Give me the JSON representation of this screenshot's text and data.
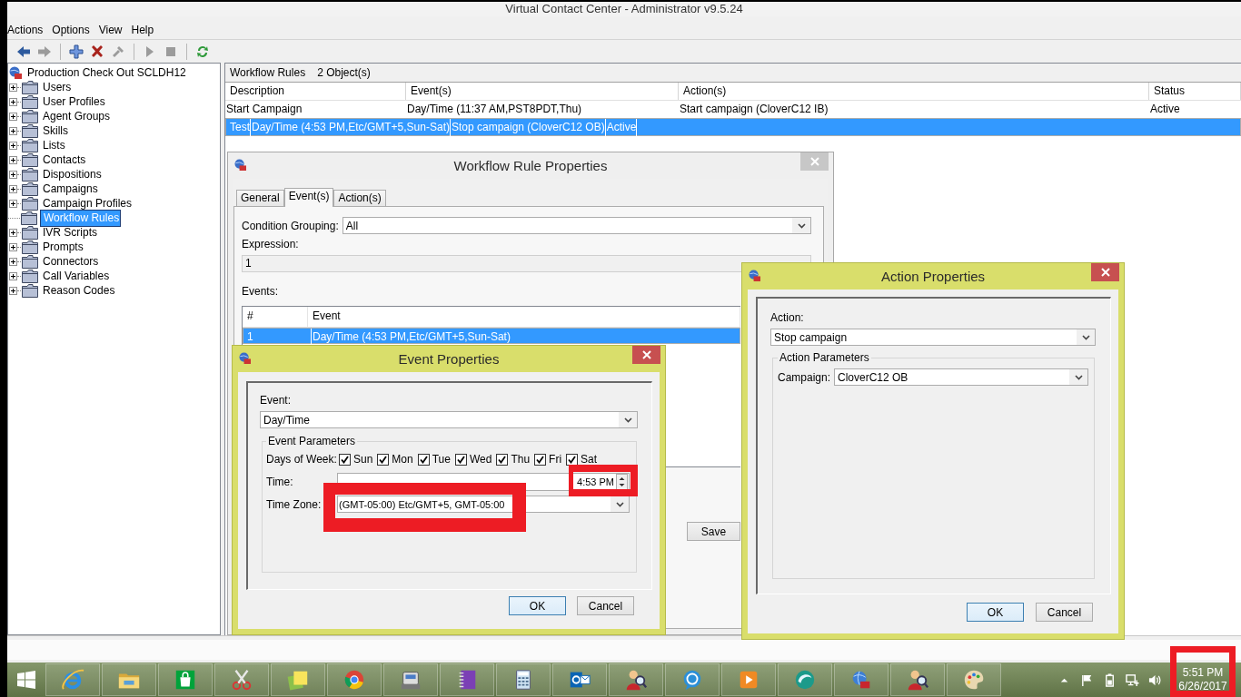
{
  "window": {
    "title": "Virtual Contact Center - Administrator v9.5.24"
  },
  "menu": [
    "Actions",
    "Options",
    "View",
    "Help"
  ],
  "toolbar": [
    [
      {
        "kind": "back",
        "disabled": false
      },
      {
        "kind": "forward",
        "disabled": true
      }
    ],
    [
      {
        "kind": "add",
        "disabled": false
      },
      {
        "kind": "delete",
        "disabled": false
      },
      {
        "kind": "tool",
        "disabled": true
      }
    ],
    [
      {
        "kind": "play",
        "disabled": true
      },
      {
        "kind": "stop",
        "disabled": true
      }
    ],
    [
      {
        "kind": "refresh",
        "disabled": false
      }
    ]
  ],
  "tree": {
    "root": {
      "label": "Production Check Out SCLDH12"
    },
    "items": [
      {
        "label": "Users",
        "expandable": true,
        "selected": false
      },
      {
        "label": "User Profiles",
        "expandable": true,
        "selected": false
      },
      {
        "label": "Agent Groups",
        "expandable": true,
        "selected": false
      },
      {
        "label": "Skills",
        "expandable": true,
        "selected": false
      },
      {
        "label": "Lists",
        "expandable": true,
        "selected": false
      },
      {
        "label": "Contacts",
        "expandable": true,
        "selected": false
      },
      {
        "label": "Dispositions",
        "expandable": true,
        "selected": false
      },
      {
        "label": "Campaigns",
        "expandable": true,
        "selected": false
      },
      {
        "label": "Campaign Profiles",
        "expandable": true,
        "selected": false
      },
      {
        "label": "Workflow Rules",
        "expandable": false,
        "selected": true
      },
      {
        "label": "IVR Scripts",
        "expandable": true,
        "selected": false
      },
      {
        "label": "Prompts",
        "expandable": true,
        "selected": false
      },
      {
        "label": "Connectors",
        "expandable": true,
        "selected": false
      },
      {
        "label": "Call Variables",
        "expandable": true,
        "selected": false
      },
      {
        "label": "Reason Codes",
        "expandable": true,
        "selected": false
      }
    ]
  },
  "list_view": {
    "title": "Workflow Rules",
    "count": "2 Object(s)",
    "columns": [
      "Description",
      "Event(s)",
      "Action(s)",
      "Status"
    ],
    "rows": [
      {
        "cells": [
          "Start Campaign",
          "Day/Time (11:37 AM,PST8PDT,Thu)",
          "Start campaign (CloverC12 IB)",
          "Active"
        ],
        "selected": false
      },
      {
        "cells": [
          "Test",
          "Day/Time (4:53 PM,Etc/GMT+5,Sun-Sat)",
          "Stop campaign (CloverC12 OB)",
          "Active"
        ],
        "selected": true
      }
    ]
  },
  "workflow_dialog": {
    "title": "Workflow Rule Properties",
    "active": false,
    "tabs": [
      {
        "label": "General",
        "selected": false
      },
      {
        "label": "Event(s)",
        "selected": true
      },
      {
        "label": "Action(s)",
        "selected": false
      }
    ],
    "condition_grouping": {
      "label": "Condition Grouping:",
      "value": "All"
    },
    "expression": {
      "label": "Expression:",
      "value": "1"
    },
    "events": {
      "label": "Events:",
      "columns": [
        "#",
        "Event"
      ],
      "rows": [
        {
          "cells": [
            "1",
            "Day/Time (4:53 PM,Etc/GMT+5,Sun-Sat)"
          ],
          "selected": true
        }
      ]
    },
    "buttons": [
      {
        "label": "Save",
        "default": false
      }
    ]
  },
  "event_dialog": {
    "title": "Event Properties",
    "active": true,
    "event": {
      "label": "Event:",
      "value": "Day/Time"
    },
    "parameters": {
      "legend": "Event Parameters",
      "days_label": "Days of Week:",
      "days": [
        {
          "label": "Sun",
          "checked": true
        },
        {
          "label": "Mon",
          "checked": true
        },
        {
          "label": "Tue",
          "checked": true
        },
        {
          "label": "Wed",
          "checked": true
        },
        {
          "label": "Thu",
          "checked": true
        },
        {
          "label": "Fri",
          "checked": true
        },
        {
          "label": "Sat",
          "checked": true
        }
      ],
      "time": {
        "label": "Time:",
        "value": "4:53 PM",
        "highlighted": true
      },
      "time_zone": {
        "label": "Time Zone:",
        "value": "(GMT-05:00) Etc/GMT+5, GMT-05:00",
        "highlighted": true
      }
    },
    "buttons": [
      {
        "label": "OK",
        "default": true
      },
      {
        "label": "Cancel",
        "default": false
      }
    ]
  },
  "action_dialog": {
    "title": "Action Properties",
    "active": true,
    "action": {
      "label": "Action:",
      "value": "Stop campaign"
    },
    "parameters": {
      "legend": "Action Parameters",
      "campaign": {
        "label": "Campaign:",
        "value": "CloverC12 OB"
      }
    },
    "buttons": [
      {
        "label": "OK",
        "default": true
      },
      {
        "label": "Cancel",
        "default": false
      }
    ]
  },
  "taskbar": {
    "apps": [
      {
        "kind": "browser-e"
      },
      {
        "kind": "folder"
      },
      {
        "kind": "bag"
      },
      {
        "kind": "scissors"
      },
      {
        "kind": "sticky-note"
      },
      {
        "kind": "segmented-circle"
      },
      {
        "kind": "device"
      },
      {
        "kind": "notebook"
      },
      {
        "kind": "calculator"
      },
      {
        "kind": "mail"
      },
      {
        "kind": "person-search"
      },
      {
        "kind": "chat"
      },
      {
        "kind": "media"
      },
      {
        "kind": "swirl"
      },
      {
        "kind": "globe"
      },
      {
        "kind": "person-search"
      },
      {
        "kind": "palette"
      }
    ],
    "tray": [
      {
        "kind": "caret-up"
      },
      {
        "kind": "flag"
      },
      {
        "kind": "battery"
      },
      {
        "kind": "network"
      },
      {
        "kind": "volume"
      }
    ],
    "clock": {
      "time": "5:51 PM",
      "date": "6/26/2017",
      "highlighted": true
    }
  }
}
